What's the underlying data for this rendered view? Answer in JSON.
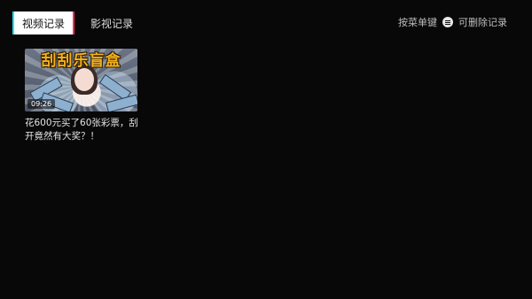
{
  "tabs": {
    "active_label": "视频记录",
    "second_label": "影视记录"
  },
  "hint": {
    "prefix": "按菜单键",
    "suffix": "可删除记录",
    "icon": "menu-icon"
  },
  "history": [
    {
      "banner_text": "刮刮乐盲盒",
      "duration": "09:26",
      "title": "花600元买了60张彩票，刮开竟然有大奖？！"
    }
  ],
  "colors": {
    "background": "#080808",
    "tab_accent_cyan": "#23e3ea",
    "tab_accent_pink": "#ff2e5b",
    "banner_text": "#f4b21f"
  }
}
